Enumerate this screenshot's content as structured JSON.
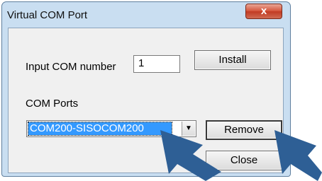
{
  "window": {
    "title": "Virtual COM Port",
    "close_glyph": "x"
  },
  "form": {
    "input_label": "Input COM number",
    "input_value": "1",
    "install_label": "Install",
    "ports_label": "COM Ports",
    "selected_port": "COM200-SISOCOM200",
    "remove_label": "Remove",
    "close_label": "Close"
  },
  "colors": {
    "selection": "#3399ff",
    "arrow": "#2e5f95"
  }
}
